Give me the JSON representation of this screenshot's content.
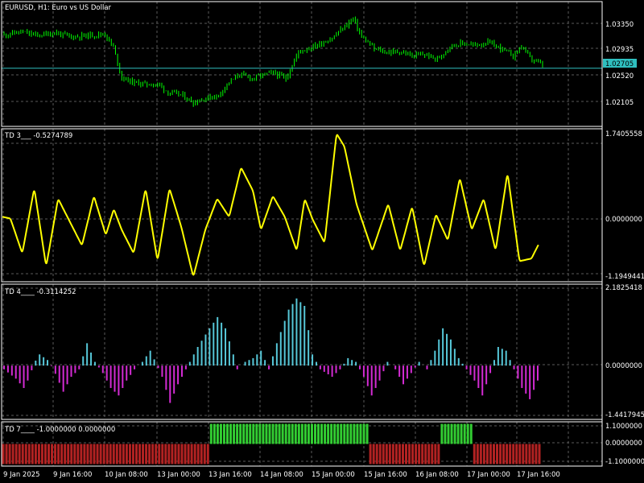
{
  "window": {
    "title": "EURUSD, H1:  Euro vs US Dollar"
  },
  "colors": {
    "background": "#000000",
    "frame": "#ffffff",
    "grid": "#5a5a5a",
    "candle": "#00ff00",
    "bid_line": "#2fbfbf",
    "td3_line": "#ffff00",
    "td4_positive": "#56c7d8",
    "td4_negative": "#d32bd3",
    "td7_positive": "#32cd32",
    "td7_negative": "#b22222"
  },
  "price_pane": {
    "axis_labels": [
      "1.03350",
      "1.02935",
      "1.02520",
      "1.02105"
    ],
    "current_price": "1.02705"
  },
  "td3_pane": {
    "title": "TD 3___",
    "value": "-0.5274789",
    "axis_labels": [
      "1.7405558",
      "0.0000000",
      "-1.1949441"
    ]
  },
  "td4_pane": {
    "title": "TD 4____",
    "value": "-0.3114252",
    "axis_labels": [
      "2.1825418",
      "0.0000000",
      "-1.4417945"
    ]
  },
  "td7_pane": {
    "title": "TD 7____",
    "value": "-1.0000000 0.0000000",
    "axis_labels": [
      "1.1000000",
      "0.0000000",
      "-1.1000000"
    ]
  },
  "time_axis": [
    "9 Jan 2025",
    "9 Jan 16:00",
    "10 Jan 08:00",
    "13 Jan 00:00",
    "13 Jan 16:00",
    "14 Jan 08:00",
    "15 Jan 00:00",
    "15 Jan 16:00",
    "16 Jan 08:00",
    "17 Jan 00:00",
    "17 Jan 16:00"
  ],
  "chart_data": [
    {
      "type": "candlestick",
      "title": "EURUSD, H1:  Euro vs US Dollar",
      "ylim": [
        1.0188,
        1.0365
      ],
      "current_price": 1.02705,
      "close_path": [
        [
          0,
          1.0318
        ],
        [
          8,
          1.0322
        ],
        [
          16,
          1.0317
        ],
        [
          24,
          1.0321
        ],
        [
          32,
          1.0315
        ],
        [
          40,
          1.0317
        ],
        [
          48,
          1.0319
        ],
        [
          52,
          1.03
        ],
        [
          56,
          1.0257
        ],
        [
          62,
          1.025
        ],
        [
          68,
          1.0248
        ],
        [
          74,
          1.0247
        ],
        [
          78,
          1.0236
        ],
        [
          84,
          1.0233
        ],
        [
          90,
          1.0222
        ],
        [
          96,
          1.0228
        ],
        [
          102,
          1.0232
        ],
        [
          106,
          1.0248
        ],
        [
          112,
          1.0262
        ],
        [
          118,
          1.0256
        ],
        [
          124,
          1.0262
        ],
        [
          128,
          1.0264
        ],
        [
          134,
          1.0256
        ],
        [
          140,
          1.0294
        ],
        [
          146,
          1.03
        ],
        [
          150,
          1.0305
        ],
        [
          156,
          1.0313
        ],
        [
          162,
          1.033
        ],
        [
          166,
          1.0341
        ],
        [
          170,
          1.0315
        ],
        [
          176,
          1.0298
        ],
        [
          182,
          1.0293
        ],
        [
          188,
          1.0294
        ],
        [
          194,
          1.0288
        ],
        [
          200,
          1.029
        ],
        [
          206,
          1.0283
        ],
        [
          212,
          1.0302
        ],
        [
          218,
          1.0306
        ],
        [
          224,
          1.0303
        ],
        [
          230,
          1.0307
        ],
        [
          236,
          1.0299
        ],
        [
          242,
          1.0288
        ],
        [
          246,
          1.0302
        ],
        [
          250,
          1.0285
        ],
        [
          256,
          1.0275
        ]
      ],
      "bar_count": 257
    },
    {
      "type": "line",
      "name": "TD 3___",
      "ylim": [
        -1.1949441,
        1.7405558
      ],
      "points": [
        [
          0,
          0.05
        ],
        [
          4,
          0.02
        ],
        [
          10,
          -0.65
        ],
        [
          16,
          0.6
        ],
        [
          22,
          -0.9
        ],
        [
          28,
          0.4
        ],
        [
          34,
          -0.05
        ],
        [
          40,
          -0.5
        ],
        [
          46,
          0.45
        ],
        [
          52,
          -0.3
        ],
        [
          56,
          0.2
        ],
        [
          60,
          -0.2
        ],
        [
          66,
          -0.65
        ],
        [
          72,
          0.6
        ],
        [
          78,
          -0.8
        ],
        [
          84,
          0.6
        ],
        [
          90,
          -0.15
        ],
        [
          96,
          -1.1
        ],
        [
          102,
          -0.2
        ],
        [
          108,
          0.4
        ],
        [
          114,
          0.05
        ],
        [
          120,
          1.0
        ],
        [
          126,
          0.55
        ],
        [
          130,
          -0.2
        ],
        [
          136,
          0.45
        ],
        [
          142,
          0.05
        ],
        [
          148,
          -0.6
        ],
        [
          152,
          0.4
        ],
        [
          156,
          0.0
        ],
        [
          162,
          -0.45
        ],
        [
          168,
          1.65
        ],
        [
          172,
          1.4
        ],
        [
          178,
          0.3
        ],
        [
          186,
          -0.6
        ],
        [
          194,
          0.3
        ],
        [
          200,
          -0.6
        ],
        [
          206,
          0.25
        ],
        [
          212,
          -0.9
        ],
        [
          218,
          0.1
        ],
        [
          224,
          -0.4
        ],
        [
          230,
          0.8
        ],
        [
          236,
          -0.2
        ],
        [
          242,
          0.4
        ],
        [
          248,
          -0.6
        ],
        [
          254,
          0.9
        ],
        [
          260,
          -0.8
        ],
        [
          266,
          -0.75
        ],
        [
          270,
          -0.45
        ]
      ]
    },
    {
      "type": "bar",
      "name": "TD 4____",
      "ylim": [
        -1.4417945,
        2.1825418
      ],
      "envelope": [
        [
          0,
          -0.1
        ],
        [
          6,
          -0.35
        ],
        [
          10,
          -0.6
        ],
        [
          13,
          -0.3
        ],
        [
          15,
          0.05
        ],
        [
          18,
          0.3
        ],
        [
          22,
          0.15
        ],
        [
          25,
          -0.1
        ],
        [
          30,
          -0.7
        ],
        [
          34,
          -0.3
        ],
        [
          38,
          -0.1
        ],
        [
          42,
          0.6
        ],
        [
          46,
          0.1
        ],
        [
          50,
          -0.2
        ],
        [
          54,
          -0.6
        ],
        [
          58,
          -0.8
        ],
        [
          62,
          -0.4
        ],
        [
          66,
          -0.1
        ],
        [
          70,
          0.1
        ],
        [
          74,
          0.4
        ],
        [
          80,
          -0.3
        ],
        [
          84,
          -1.0
        ],
        [
          88,
          -0.5
        ],
        [
          92,
          -0.1
        ],
        [
          98,
          0.5
        ],
        [
          104,
          1.0
        ],
        [
          108,
          1.3
        ],
        [
          112,
          1.0
        ],
        [
          116,
          0.3
        ],
        [
          118,
          -0.1
        ],
        [
          122,
          0.1
        ],
        [
          126,
          0.2
        ],
        [
          130,
          0.4
        ],
        [
          134,
          -0.1
        ],
        [
          138,
          0.6
        ],
        [
          144,
          1.5
        ],
        [
          148,
          1.8
        ],
        [
          152,
          1.6
        ],
        [
          156,
          0.3
        ],
        [
          160,
          -0.1
        ],
        [
          166,
          -0.3
        ],
        [
          170,
          -0.1
        ],
        [
          174,
          0.2
        ],
        [
          178,
          0.1
        ],
        [
          182,
          -0.3
        ],
        [
          186,
          -0.8
        ],
        [
          190,
          -0.4
        ],
        [
          194,
          0.1
        ],
        [
          198,
          -0.1
        ],
        [
          202,
          -0.5
        ],
        [
          206,
          -0.2
        ],
        [
          210,
          0.1
        ],
        [
          214,
          -0.1
        ],
        [
          218,
          0.4
        ],
        [
          222,
          1.0
        ],
        [
          226,
          0.7
        ],
        [
          230,
          0.2
        ],
        [
          234,
          -0.1
        ],
        [
          238,
          -0.4
        ],
        [
          242,
          -0.8
        ],
        [
          246,
          -0.2
        ],
        [
          250,
          0.5
        ],
        [
          254,
          0.4
        ],
        [
          258,
          -0.1
        ],
        [
          262,
          -0.6
        ],
        [
          266,
          -0.9
        ],
        [
          270,
          -0.4
        ]
      ]
    },
    {
      "type": "bar",
      "name": "TD 7____",
      "ylim": [
        -1.1,
        1.1
      ],
      "segments": [
        [
          0,
          63,
          -1
        ],
        [
          64,
          112,
          1
        ],
        [
          113,
          134,
          -1
        ],
        [
          135,
          144,
          1
        ],
        [
          145,
          165,
          -1
        ]
      ]
    }
  ]
}
